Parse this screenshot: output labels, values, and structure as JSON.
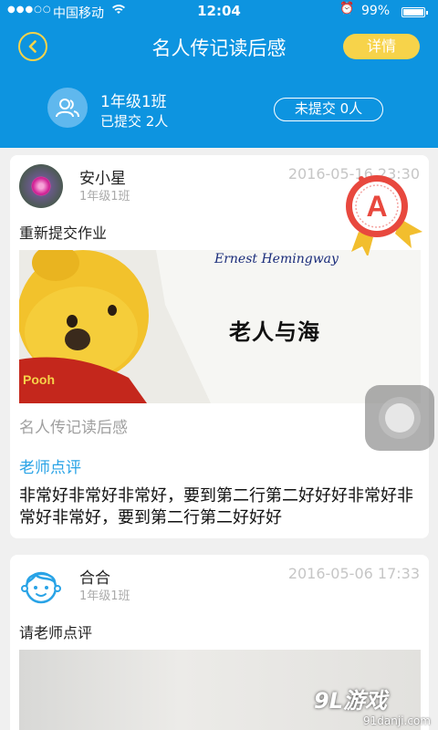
{
  "status_bar": {
    "carrier": "中国移动",
    "time": "12:04",
    "battery_percent": "99%",
    "battery_level": 0.99
  },
  "nav": {
    "title": "名人传记读后感",
    "detail_label": "详情"
  },
  "class_info": {
    "name": "1年级1班",
    "submitted": "已提交 2人",
    "unsubmitted_label": "未提交 0人"
  },
  "posts": [
    {
      "student_name": "安小星",
      "student_class": "1年级1班",
      "timestamp": "2016-05-16 23:30",
      "request": "重新提交作业",
      "grade": "A",
      "photo_caption": "老人与海",
      "photo_signature": "Ernest Hemingway",
      "photo_toy_label": "Pooh",
      "essay_title": "名人传记读后感",
      "comment_label": "老师点评",
      "comment": "非常好非常好非常好，要到第二行第二好好好非常好非常好非常好，要到第二行第二好好好"
    },
    {
      "student_name": "合合",
      "student_class": "1年级1班",
      "timestamp": "2016-05-06 17:33",
      "request": "请老师点评"
    }
  ],
  "watermark": {
    "logo": "9L游戏",
    "url": "91danji.com"
  },
  "colors": {
    "primary": "#0d94e0",
    "accent_yellow": "#f7d34a",
    "comment_blue": "#29a3e6",
    "grade_red": "#e8483e"
  }
}
